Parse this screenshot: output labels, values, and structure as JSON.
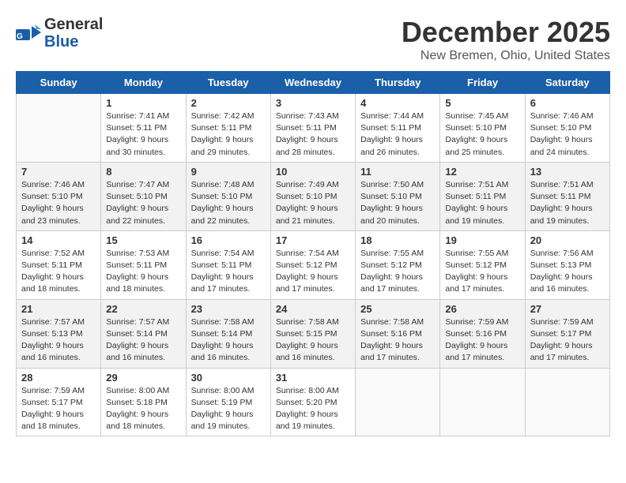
{
  "logo": {
    "line1": "General",
    "line2": "Blue"
  },
  "title": "December 2025",
  "location": "New Bremen, Ohio, United States",
  "days_header": [
    "Sunday",
    "Monday",
    "Tuesday",
    "Wednesday",
    "Thursday",
    "Friday",
    "Saturday"
  ],
  "weeks": [
    [
      {
        "day": "",
        "info": ""
      },
      {
        "day": "1",
        "info": "Sunrise: 7:41 AM\nSunset: 5:11 PM\nDaylight: 9 hours\nand 30 minutes."
      },
      {
        "day": "2",
        "info": "Sunrise: 7:42 AM\nSunset: 5:11 PM\nDaylight: 9 hours\nand 29 minutes."
      },
      {
        "day": "3",
        "info": "Sunrise: 7:43 AM\nSunset: 5:11 PM\nDaylight: 9 hours\nand 28 minutes."
      },
      {
        "day": "4",
        "info": "Sunrise: 7:44 AM\nSunset: 5:11 PM\nDaylight: 9 hours\nand 26 minutes."
      },
      {
        "day": "5",
        "info": "Sunrise: 7:45 AM\nSunset: 5:10 PM\nDaylight: 9 hours\nand 25 minutes."
      },
      {
        "day": "6",
        "info": "Sunrise: 7:46 AM\nSunset: 5:10 PM\nDaylight: 9 hours\nand 24 minutes."
      }
    ],
    [
      {
        "day": "7",
        "info": "Sunrise: 7:46 AM\nSunset: 5:10 PM\nDaylight: 9 hours\nand 23 minutes."
      },
      {
        "day": "8",
        "info": "Sunrise: 7:47 AM\nSunset: 5:10 PM\nDaylight: 9 hours\nand 22 minutes."
      },
      {
        "day": "9",
        "info": "Sunrise: 7:48 AM\nSunset: 5:10 PM\nDaylight: 9 hours\nand 22 minutes."
      },
      {
        "day": "10",
        "info": "Sunrise: 7:49 AM\nSunset: 5:10 PM\nDaylight: 9 hours\nand 21 minutes."
      },
      {
        "day": "11",
        "info": "Sunrise: 7:50 AM\nSunset: 5:10 PM\nDaylight: 9 hours\nand 20 minutes."
      },
      {
        "day": "12",
        "info": "Sunrise: 7:51 AM\nSunset: 5:11 PM\nDaylight: 9 hours\nand 19 minutes."
      },
      {
        "day": "13",
        "info": "Sunrise: 7:51 AM\nSunset: 5:11 PM\nDaylight: 9 hours\nand 19 minutes."
      }
    ],
    [
      {
        "day": "14",
        "info": "Sunrise: 7:52 AM\nSunset: 5:11 PM\nDaylight: 9 hours\nand 18 minutes."
      },
      {
        "day": "15",
        "info": "Sunrise: 7:53 AM\nSunset: 5:11 PM\nDaylight: 9 hours\nand 18 minutes."
      },
      {
        "day": "16",
        "info": "Sunrise: 7:54 AM\nSunset: 5:11 PM\nDaylight: 9 hours\nand 17 minutes."
      },
      {
        "day": "17",
        "info": "Sunrise: 7:54 AM\nSunset: 5:12 PM\nDaylight: 9 hours\nand 17 minutes."
      },
      {
        "day": "18",
        "info": "Sunrise: 7:55 AM\nSunset: 5:12 PM\nDaylight: 9 hours\nand 17 minutes."
      },
      {
        "day": "19",
        "info": "Sunrise: 7:55 AM\nSunset: 5:12 PM\nDaylight: 9 hours\nand 17 minutes."
      },
      {
        "day": "20",
        "info": "Sunrise: 7:56 AM\nSunset: 5:13 PM\nDaylight: 9 hours\nand 16 minutes."
      }
    ],
    [
      {
        "day": "21",
        "info": "Sunrise: 7:57 AM\nSunset: 5:13 PM\nDaylight: 9 hours\nand 16 minutes."
      },
      {
        "day": "22",
        "info": "Sunrise: 7:57 AM\nSunset: 5:14 PM\nDaylight: 9 hours\nand 16 minutes."
      },
      {
        "day": "23",
        "info": "Sunrise: 7:58 AM\nSunset: 5:14 PM\nDaylight: 9 hours\nand 16 minutes."
      },
      {
        "day": "24",
        "info": "Sunrise: 7:58 AM\nSunset: 5:15 PM\nDaylight: 9 hours\nand 16 minutes."
      },
      {
        "day": "25",
        "info": "Sunrise: 7:58 AM\nSunset: 5:16 PM\nDaylight: 9 hours\nand 17 minutes."
      },
      {
        "day": "26",
        "info": "Sunrise: 7:59 AM\nSunset: 5:16 PM\nDaylight: 9 hours\nand 17 minutes."
      },
      {
        "day": "27",
        "info": "Sunrise: 7:59 AM\nSunset: 5:17 PM\nDaylight: 9 hours\nand 17 minutes."
      }
    ],
    [
      {
        "day": "28",
        "info": "Sunrise: 7:59 AM\nSunset: 5:17 PM\nDaylight: 9 hours\nand 18 minutes."
      },
      {
        "day": "29",
        "info": "Sunrise: 8:00 AM\nSunset: 5:18 PM\nDaylight: 9 hours\nand 18 minutes."
      },
      {
        "day": "30",
        "info": "Sunrise: 8:00 AM\nSunset: 5:19 PM\nDaylight: 9 hours\nand 19 minutes."
      },
      {
        "day": "31",
        "info": "Sunrise: 8:00 AM\nSunset: 5:20 PM\nDaylight: 9 hours\nand 19 minutes."
      },
      {
        "day": "",
        "info": ""
      },
      {
        "day": "",
        "info": ""
      },
      {
        "day": "",
        "info": ""
      }
    ]
  ]
}
